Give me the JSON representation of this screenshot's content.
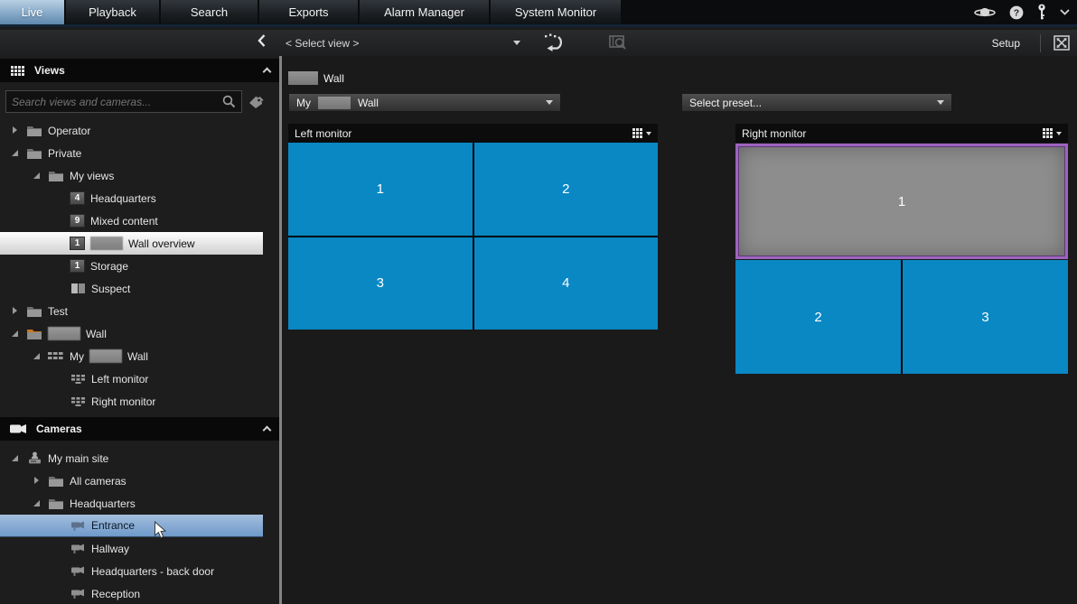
{
  "window": {
    "tabs": [
      {
        "label": "Live",
        "active": true
      },
      {
        "label": "Playback",
        "active": false
      },
      {
        "label": "Search",
        "active": false
      },
      {
        "label": "Exports",
        "active": false
      },
      {
        "label": "Alarm Manager",
        "active": false
      },
      {
        "label": "System Monitor",
        "active": false
      }
    ],
    "top_icons": [
      "cloud-status-icon",
      "help-icon",
      "login-key-icon",
      "chevron-down-icon"
    ]
  },
  "toolbar": {
    "collapse_icon": "collapse-sidebar-icon",
    "view_selector_label": "< Select view >",
    "icons": [
      "revert-view-icon",
      "evidence-lock-search-icon"
    ],
    "setup_label": "Setup",
    "fullscreen_icon": "toggle-window-mode-icon"
  },
  "sidebar": {
    "views_panel": {
      "title": "Views",
      "header_icon": "views-grid-icon",
      "collapse_icon": "collapse-panel-icon",
      "search_placeholder": "Search views and cameras...",
      "search_icons": [
        "search-icon",
        "tag-icon"
      ],
      "tree": [
        {
          "label": "Operator",
          "indent": 1,
          "icon": "folder",
          "expand": "collapsed"
        },
        {
          "label": "Private",
          "indent": 1,
          "icon": "folder",
          "expand": "expanded"
        },
        {
          "label": "My views",
          "indent": 2,
          "icon": "folder",
          "expand": "expanded"
        },
        {
          "label": "Headquarters",
          "indent": 3,
          "badge": "4"
        },
        {
          "label": "Mixed content",
          "indent": 3,
          "badge": "9"
        },
        {
          "label": "Wall overview",
          "indent": 3,
          "badge": "1",
          "redacted_prefix": true,
          "selected": true
        },
        {
          "label": "Storage",
          "indent": 3,
          "badge": "1"
        },
        {
          "label": "Suspect",
          "indent": 3,
          "icon": "split-view"
        },
        {
          "label": "Test",
          "indent": 1,
          "icon": "folder",
          "expand": "collapsed"
        },
        {
          "label": "Wall",
          "indent": 1,
          "icon": "folder-orange",
          "expand": "expanded",
          "redacted_prefix": true
        },
        {
          "label": "Wall",
          "prefix": "My",
          "indent": 2,
          "icon": "wall-grid",
          "expand": "expanded",
          "redacted_prefix": true
        },
        {
          "label": "Left monitor",
          "indent": 3,
          "icon": "monitor"
        },
        {
          "label": "Right monitor",
          "indent": 3,
          "icon": "monitor"
        }
      ]
    },
    "cameras_panel": {
      "title": "Cameras",
      "header_icon": "video-camera-icon",
      "collapse_icon": "collapse-panel-icon",
      "tree": [
        {
          "label": "My main site",
          "indent": 1,
          "icon": "site",
          "expand": "expanded"
        },
        {
          "label": "All cameras",
          "indent": 2,
          "icon": "folder",
          "expand": "collapsed"
        },
        {
          "label": "Headquarters",
          "indent": 2,
          "icon": "folder",
          "expand": "expanded"
        },
        {
          "label": "Entrance",
          "indent": 3,
          "icon": "camera",
          "selected": true
        },
        {
          "label": "Hallway",
          "indent": 3,
          "icon": "camera"
        },
        {
          "label": "Headquarters - back door",
          "indent": 3,
          "icon": "camera"
        },
        {
          "label": "Reception",
          "indent": 3,
          "icon": "camera"
        }
      ]
    }
  },
  "main": {
    "title": {
      "redacted_prefix": true,
      "text": "Wall"
    },
    "wall_selector": {
      "prefix": "My",
      "redacted_infix": true,
      "suffix": "Wall"
    },
    "preset_selector": {
      "value": "Select preset..."
    },
    "monitors": [
      {
        "title": "Left monitor",
        "layout": "2x2",
        "tiles": [
          {
            "n": "1"
          },
          {
            "n": "2"
          },
          {
            "n": "3"
          },
          {
            "n": "4"
          }
        ]
      },
      {
        "title": "Right monitor",
        "layout": "top-span",
        "tiles": [
          {
            "n": "1",
            "selected": true
          },
          {
            "n": "2"
          },
          {
            "n": "3"
          }
        ]
      }
    ]
  },
  "colors": {
    "tile_blue": "#0988c4",
    "tile_selected_gray": "#8d8d8d",
    "selection_purple": "#9c64be",
    "row_selected_light": "#d9d9d9",
    "row_selected_blue": "#84a9d4",
    "tab_active_blue": "#6d94b8"
  }
}
